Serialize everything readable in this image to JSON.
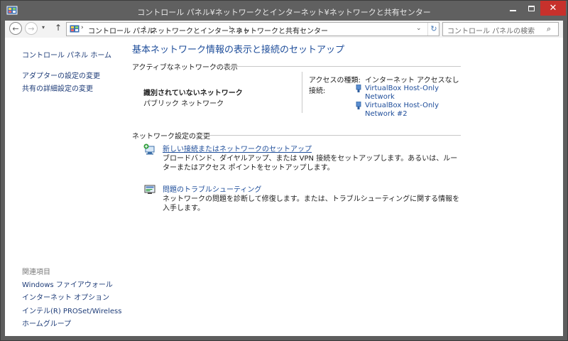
{
  "window": {
    "title": "コントロール パネル¥ネットワークとインターネット¥ネットワークと共有センター",
    "close_symbol": "✕"
  },
  "nav": {
    "back": "←",
    "forward": "→",
    "recent": "▾",
    "up": "↑",
    "breadcrumb": [
      "コントロール パネル",
      "ネットワークとインターネット",
      "ネットワークと共有センター"
    ],
    "breadcrumb_sep": "›",
    "dropdown": "⌄",
    "refresh": "↻",
    "search_placeholder": "コントロール パネルの検索",
    "search_icon": "⌕"
  },
  "sidebar": {
    "home": "コントロール パネル ホーム",
    "links": [
      "アダプターの設定の変更",
      "共有の詳細設定の変更"
    ],
    "related_heading": "関連項目",
    "related": [
      "Windows ファイアウォール",
      "インターネット オプション",
      "インテル(R) PROSet/Wireless",
      "ホームグループ"
    ]
  },
  "main": {
    "title": "基本ネットワーク情報の表示と接続のセットアップ",
    "active_heading": "アクティブなネットワークの表示",
    "network_name": "識別されていないネットワーク",
    "network_type": "パブリック ネットワーク",
    "access_label": "アクセスの種類:",
    "access_value": "インターネット アクセスなし",
    "connection_label": "接続:",
    "connections": [
      {
        "line1": "VirtualBox Host-Only",
        "line2": "Network"
      },
      {
        "line1": "VirtualBox Host-Only",
        "line2": "Network #2"
      }
    ],
    "change_heading": "ネットワーク設定の変更",
    "tasks": [
      {
        "link": "新しい接続またはネットワークのセットアップ",
        "desc": "ブロードバンド、ダイヤルアップ、または VPN 接続をセットアップします。あるいは、ルーターまたはアクセス ポイントをセットアップします。",
        "icon": "network-setup-icon"
      },
      {
        "link": "問題のトラブルシューティング",
        "desc": "ネットワークの問題を診断して修復します。または、トラブルシューティングに関する情報を入手します。",
        "icon": "troubleshoot-icon"
      }
    ]
  },
  "colors": {
    "link": "#1e4d9a",
    "title_bar": "#606060",
    "close_button": "#c7312c"
  }
}
